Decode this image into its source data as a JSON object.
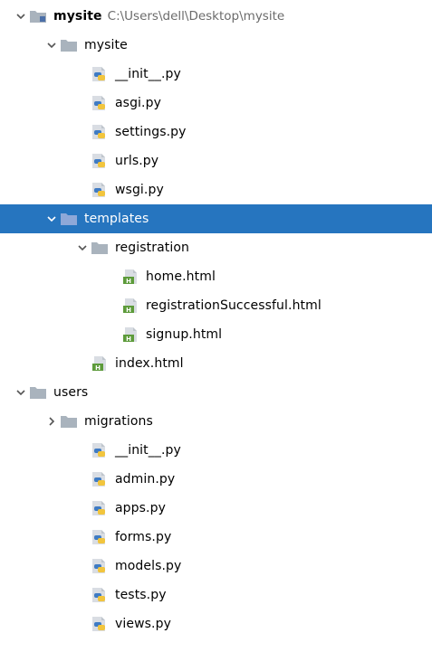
{
  "colors": {
    "selection": "#2675bf",
    "folder": "#a9b3bd",
    "python_blue": "#3f7bc4",
    "python_yellow": "#f2c53d",
    "html_green": "#5d9b3b"
  },
  "rows": [
    {
      "label": "mysite",
      "path": "C:\\Users\\dell\\Desktop\\mysite",
      "icon": "module-folder-icon",
      "chevron": "expanded",
      "depth": 0,
      "bold": true
    },
    {
      "label": "mysite",
      "icon": "folder-icon",
      "chevron": "expanded",
      "depth": 1
    },
    {
      "label": "__init__.py",
      "icon": "python-file-icon",
      "depth": 2
    },
    {
      "label": "asgi.py",
      "icon": "python-file-icon",
      "depth": 2
    },
    {
      "label": "settings.py",
      "icon": "python-file-icon",
      "depth": 2
    },
    {
      "label": "urls.py",
      "icon": "python-file-icon",
      "depth": 2
    },
    {
      "label": "wsgi.py",
      "icon": "python-file-icon",
      "depth": 2
    },
    {
      "label": "templates",
      "icon": "templates-folder-icon",
      "chevron": "expanded",
      "depth": 1,
      "selected": true
    },
    {
      "label": "registration",
      "icon": "folder-icon",
      "chevron": "expanded",
      "depth": 2
    },
    {
      "label": "home.html",
      "icon": "html-file-icon",
      "depth": 3
    },
    {
      "label": "registrationSuccessful.html",
      "icon": "html-file-icon",
      "depth": 3
    },
    {
      "label": "signup.html",
      "icon": "html-file-icon",
      "depth": 3
    },
    {
      "label": "index.html",
      "icon": "html-file-icon",
      "depth": 2
    },
    {
      "label": "users",
      "icon": "folder-icon",
      "chevron": "expanded",
      "depth": 0
    },
    {
      "label": "migrations",
      "icon": "folder-icon",
      "chevron": "collapsed",
      "depth": 1
    },
    {
      "label": "__init__.py",
      "icon": "python-file-icon",
      "depth": 2
    },
    {
      "label": "admin.py",
      "icon": "python-file-icon",
      "depth": 2
    },
    {
      "label": "apps.py",
      "icon": "python-file-icon",
      "depth": 2
    },
    {
      "label": "forms.py",
      "icon": "python-file-icon",
      "depth": 2
    },
    {
      "label": "models.py",
      "icon": "python-file-icon",
      "depth": 2
    },
    {
      "label": "tests.py",
      "icon": "python-file-icon",
      "depth": 2
    },
    {
      "label": "views.py",
      "icon": "python-file-icon",
      "depth": 2
    }
  ]
}
